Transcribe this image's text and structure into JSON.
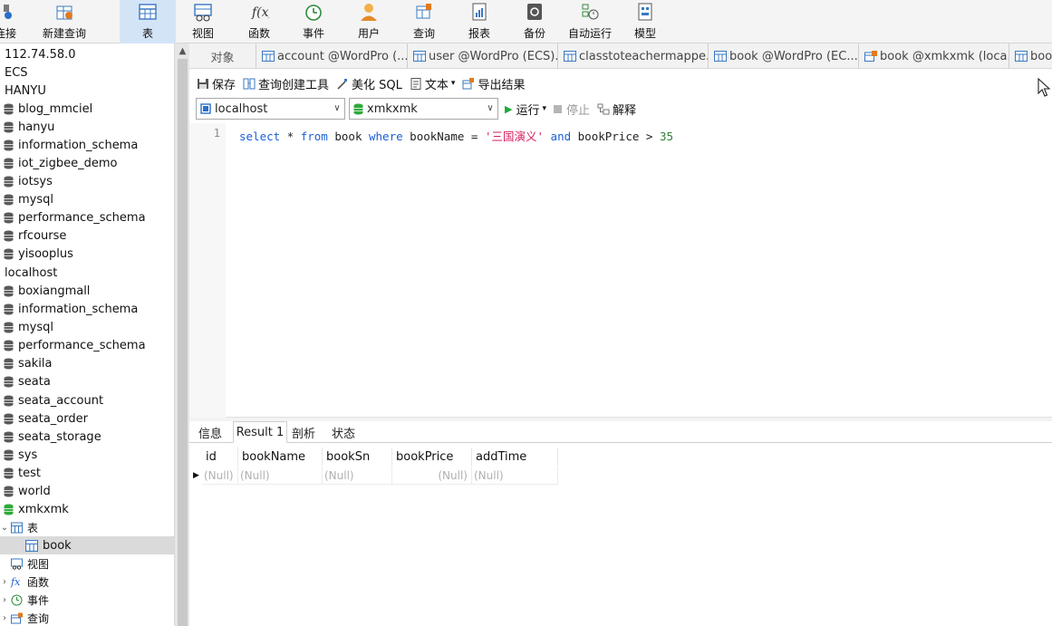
{
  "toolbar": {
    "items": [
      {
        "label": "连接",
        "icon": "connect-icon"
      },
      {
        "label": "新建查询",
        "icon": "new-query-icon"
      },
      {
        "label": "表",
        "icon": "table-icon",
        "active": true
      },
      {
        "label": "视图",
        "icon": "view-icon"
      },
      {
        "label": "函数",
        "icon": "function-icon"
      },
      {
        "label": "事件",
        "icon": "event-clock-icon"
      },
      {
        "label": "用户",
        "icon": "user-icon"
      },
      {
        "label": "查询",
        "icon": "query-icon"
      },
      {
        "label": "报表",
        "icon": "report-icon"
      },
      {
        "label": "备份",
        "icon": "backup-icon"
      },
      {
        "label": "自动运行",
        "icon": "schedule-icon"
      },
      {
        "label": "模型",
        "icon": "model-icon"
      }
    ]
  },
  "sidebar": {
    "items": [
      {
        "label": "112.74.58.0",
        "type": "connection"
      },
      {
        "label": "ECS",
        "type": "connection"
      },
      {
        "label": "HANYU",
        "type": "connection"
      },
      {
        "label": "blog_mmciel",
        "type": "db"
      },
      {
        "label": "hanyu",
        "type": "db"
      },
      {
        "label": "information_schema",
        "type": "db"
      },
      {
        "label": "iot_zigbee_demo",
        "type": "db"
      },
      {
        "label": "iotsys",
        "type": "db"
      },
      {
        "label": "mysql",
        "type": "db"
      },
      {
        "label": "performance_schema",
        "type": "db"
      },
      {
        "label": "rfcourse",
        "type": "db"
      },
      {
        "label": "yisooplus",
        "type": "db"
      },
      {
        "label": "localhost",
        "type": "connection"
      },
      {
        "label": "boxiangmall",
        "type": "db"
      },
      {
        "label": "information_schema",
        "type": "db"
      },
      {
        "label": "mysql",
        "type": "db"
      },
      {
        "label": "performance_schema",
        "type": "db"
      },
      {
        "label": "sakila",
        "type": "db"
      },
      {
        "label": "seata",
        "type": "db"
      },
      {
        "label": "seata_account",
        "type": "db"
      },
      {
        "label": "seata_order",
        "type": "db"
      },
      {
        "label": "seata_storage",
        "type": "db"
      },
      {
        "label": "sys",
        "type": "db"
      },
      {
        "label": "test",
        "type": "db"
      },
      {
        "label": "world",
        "type": "db"
      },
      {
        "label": "xmkxmk",
        "type": "db-open"
      },
      {
        "label": "表",
        "type": "folder-tables"
      },
      {
        "label": "book",
        "type": "table",
        "selected": true
      },
      {
        "label": "视图",
        "type": "folder-views"
      },
      {
        "label": "函数",
        "type": "folder-functions"
      },
      {
        "label": "事件",
        "type": "folder-events"
      },
      {
        "label": "查询",
        "type": "folder-queries"
      }
    ]
  },
  "tabs": [
    {
      "label": "对象",
      "kind": "object"
    },
    {
      "label": "account @WordPro (...",
      "kind": "table"
    },
    {
      "label": "user @WordPro (ECS)...",
      "kind": "table"
    },
    {
      "label": "classtoteachermappe...",
      "kind": "table"
    },
    {
      "label": "book @WordPro (EC...",
      "kind": "table"
    },
    {
      "label": "book @xmkxmk (loca...",
      "kind": "query"
    },
    {
      "label": "boo",
      "kind": "table"
    }
  ],
  "editor_toolbar": {
    "save": "保存",
    "query_builder": "查询创建工具",
    "beautify": "美化 SQL",
    "text": "文本",
    "export": "导出结果",
    "run": "运行",
    "stop": "停止",
    "explain": "解释"
  },
  "selectors": {
    "connection": "localhost",
    "database": "xmkxmk"
  },
  "editor": {
    "line_number": "1",
    "tokens": [
      {
        "t": "select",
        "c": "kw"
      },
      {
        "t": " * ",
        "c": "pl"
      },
      {
        "t": "from",
        "c": "kw"
      },
      {
        "t": " book ",
        "c": "pl"
      },
      {
        "t": "where",
        "c": "kw"
      },
      {
        "t": " bookName = ",
        "c": "pl"
      },
      {
        "t": "'三国演义'",
        "c": "str"
      },
      {
        "t": " ",
        "c": "pl"
      },
      {
        "t": "and",
        "c": "kw"
      },
      {
        "t": " bookPrice > ",
        "c": "pl"
      },
      {
        "t": "35",
        "c": "num"
      }
    ]
  },
  "result_tabs": [
    {
      "label": "信息"
    },
    {
      "label": "Result 1",
      "active": true
    },
    {
      "label": "剖析"
    },
    {
      "label": "状态"
    }
  ],
  "result_grid": {
    "columns": [
      "id",
      "bookName",
      "bookSn",
      "bookPrice",
      "addTime"
    ],
    "rows": [
      [
        "(Null)",
        "(Null)",
        "(Null)",
        "(Null)",
        "(Null)"
      ]
    ]
  },
  "colors": {
    "keyword": "#1b5fd6",
    "string": "#d81b60",
    "number": "#2e7d32",
    "db_icon": "#5a5a5a",
    "db_open_icon": "#2eaa3a",
    "run_green": "#1faa3a",
    "active_toolbar": "#d4e4f7"
  }
}
